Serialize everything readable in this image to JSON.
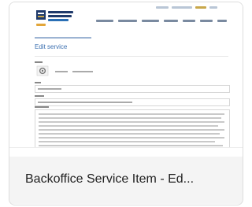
{
  "thumbnail": {
    "page_title": "Edit service"
  },
  "card": {
    "caption": "Backoffice Service Item - Ed..."
  },
  "colors": {
    "accent": "#c8a74a",
    "link": "#3b6fb0",
    "brand_navy": "#1f3a6b"
  },
  "icons": {
    "logo": "logo-mark",
    "service_icon": "settings-cog-icon"
  }
}
